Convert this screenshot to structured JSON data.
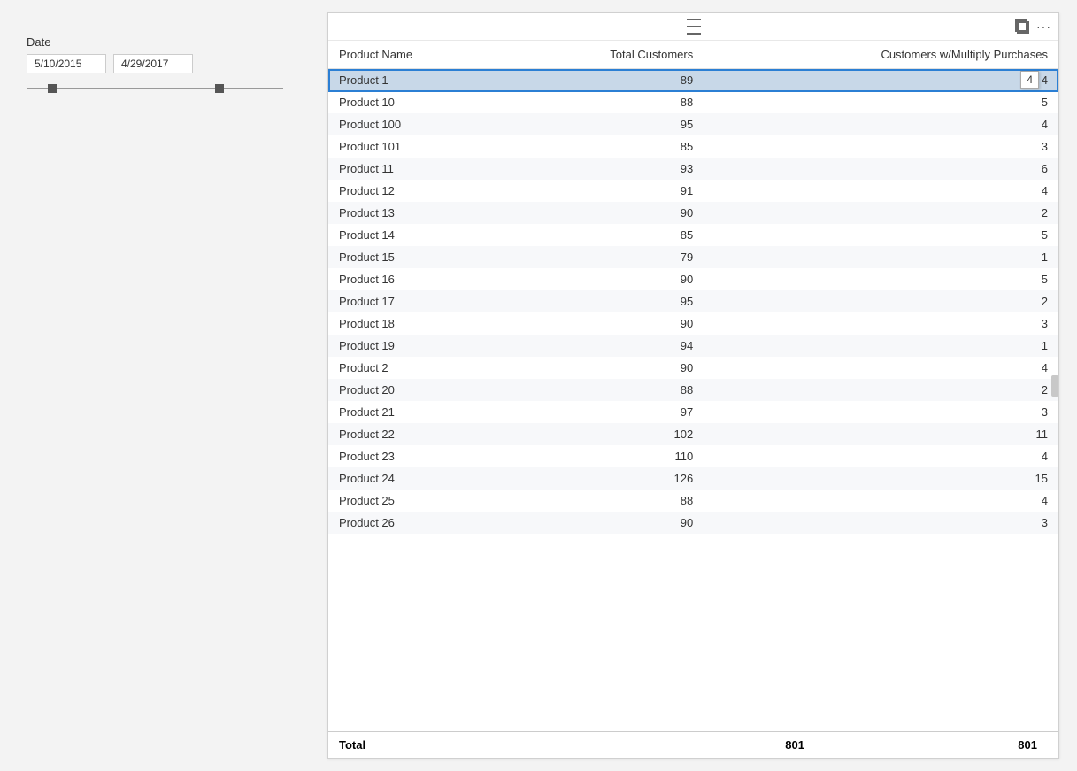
{
  "dateFilter": {
    "label": "Date",
    "startDate": "5/10/2015",
    "endDate": "4/29/2017",
    "sliderLeftPct": 10,
    "sliderRightPct": 75
  },
  "table": {
    "columns": [
      {
        "key": "product",
        "label": "Product Name",
        "align": "left"
      },
      {
        "key": "customers",
        "label": "Total Customers",
        "align": "right"
      },
      {
        "key": "multiply",
        "label": "Customers w/Multiply Purchases",
        "align": "right"
      }
    ],
    "rows": [
      {
        "product": "Product 1",
        "customers": 89,
        "multiply": 4,
        "selected": true
      },
      {
        "product": "Product 10",
        "customers": 88,
        "multiply": 5,
        "selected": false
      },
      {
        "product": "Product 100",
        "customers": 95,
        "multiply": 4,
        "selected": false
      },
      {
        "product": "Product 101",
        "customers": 85,
        "multiply": 3,
        "selected": false
      },
      {
        "product": "Product 11",
        "customers": 93,
        "multiply": 6,
        "selected": false
      },
      {
        "product": "Product 12",
        "customers": 91,
        "multiply": 4,
        "selected": false
      },
      {
        "product": "Product 13",
        "customers": 90,
        "multiply": 2,
        "selected": false
      },
      {
        "product": "Product 14",
        "customers": 85,
        "multiply": 5,
        "selected": false
      },
      {
        "product": "Product 15",
        "customers": 79,
        "multiply": 1,
        "selected": false
      },
      {
        "product": "Product 16",
        "customers": 90,
        "multiply": 5,
        "selected": false
      },
      {
        "product": "Product 17",
        "customers": 95,
        "multiply": 2,
        "selected": false
      },
      {
        "product": "Product 18",
        "customers": 90,
        "multiply": 3,
        "selected": false
      },
      {
        "product": "Product 19",
        "customers": 94,
        "multiply": 1,
        "selected": false
      },
      {
        "product": "Product 2",
        "customers": 90,
        "multiply": 4,
        "selected": false
      },
      {
        "product": "Product 20",
        "customers": 88,
        "multiply": 2,
        "selected": false
      },
      {
        "product": "Product 21",
        "customers": 97,
        "multiply": 3,
        "selected": false
      },
      {
        "product": "Product 22",
        "customers": 102,
        "multiply": 11,
        "selected": false
      },
      {
        "product": "Product 23",
        "customers": 110,
        "multiply": 4,
        "selected": false
      },
      {
        "product": "Product 24",
        "customers": 126,
        "multiply": 15,
        "selected": false
      },
      {
        "product": "Product 25",
        "customers": 88,
        "multiply": 4,
        "selected": false
      },
      {
        "product": "Product 26",
        "customers": 90,
        "multiply": 3,
        "selected": false
      }
    ],
    "total": {
      "label": "Total",
      "customers": 801,
      "multiply": 801
    },
    "tooltip": {
      "value": "4",
      "visible": true
    }
  },
  "icons": {
    "hamburger": "≡",
    "expand": "⊡",
    "dots": "···"
  }
}
